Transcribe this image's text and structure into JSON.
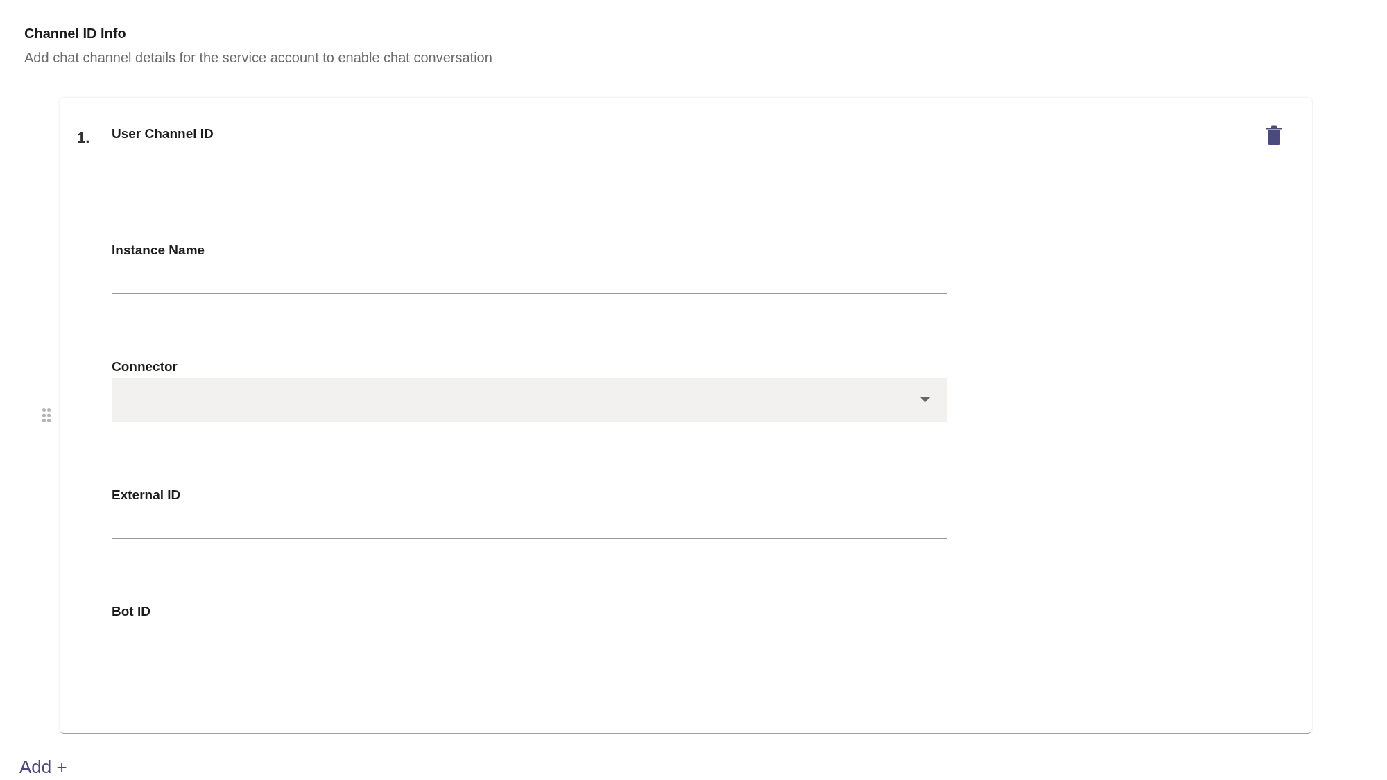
{
  "section": {
    "title": "Channel ID Info",
    "description": "Add chat channel details for the service account to enable chat conversation"
  },
  "channels": [
    {
      "number": "1.",
      "fields": [
        {
          "kind": "text",
          "label": "User Channel ID"
        },
        {
          "kind": "text",
          "label": "Instance Name"
        },
        {
          "kind": "select",
          "label": "Connector"
        },
        {
          "kind": "text",
          "label": "External ID"
        },
        {
          "kind": "text",
          "label": "Bot ID"
        }
      ]
    }
  ],
  "add_button": "Add +"
}
